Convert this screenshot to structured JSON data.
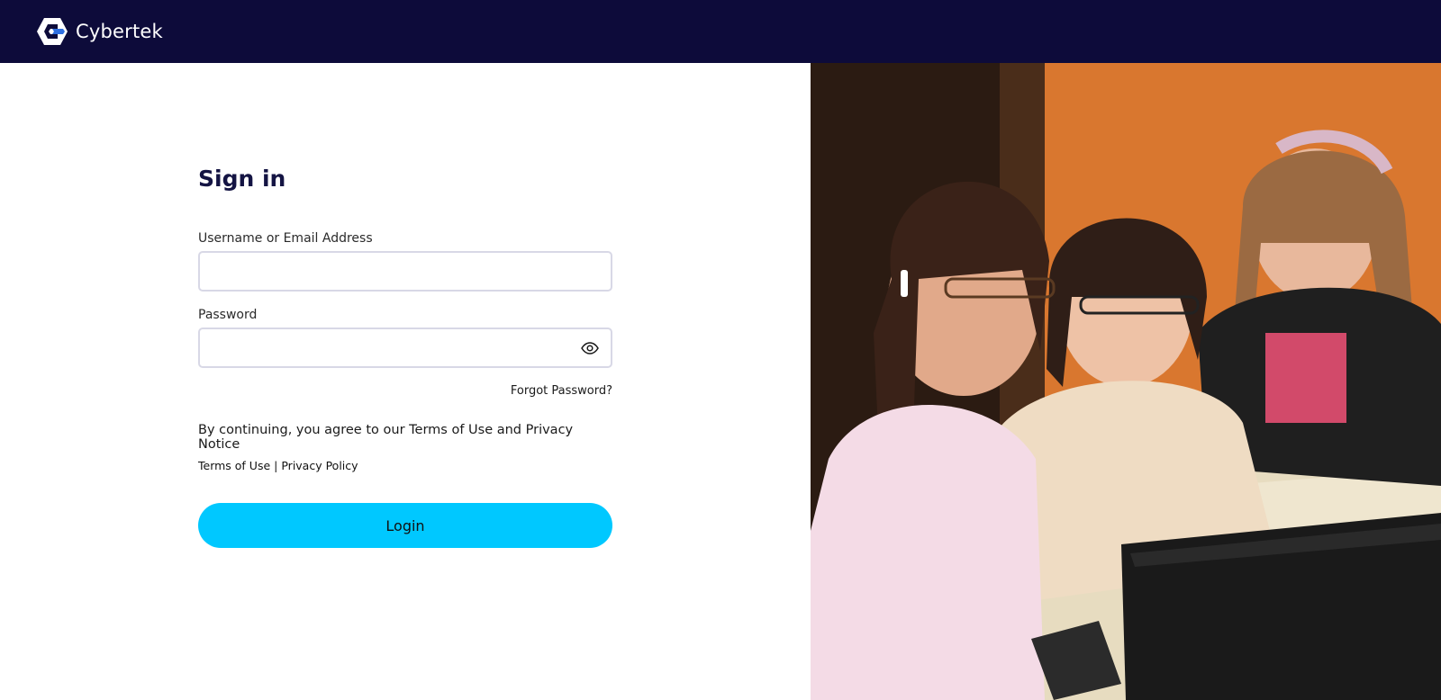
{
  "header": {
    "brand_name": "Cybertek",
    "logo_icon": "cybertek-logo-icon",
    "background_color": "#0d0b3a"
  },
  "signin": {
    "title": "Sign in",
    "username_label": "Username or Email Address",
    "username_value": "",
    "password_label": "Password",
    "password_value": "",
    "password_toggle_icon": "eye-icon",
    "forgot_password": "Forgot Password?",
    "agree_text": "By continuing, you agree to our Terms of Use and Privacy Notice",
    "terms_link": "Terms of Use",
    "separator": "|",
    "privacy_link": "Privacy Policy",
    "login_button": "Login",
    "accent_color": "#00c8ff"
  },
  "hero": {
    "photo": "three-women-looking-at-computer-photo"
  }
}
